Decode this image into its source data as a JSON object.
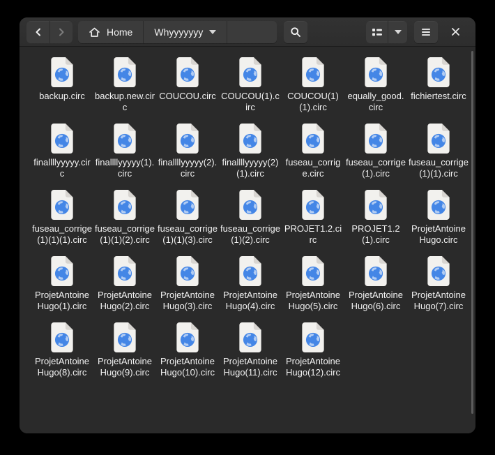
{
  "headerbar": {
    "home_label": "Home",
    "current_folder": "Whyyyyyyy",
    "path_entry_value": ""
  },
  "icons": {
    "back": "chevron-left-icon",
    "forward": "chevron-right-icon",
    "home": "house-icon",
    "folder_dropdown": "chevron-down-icon",
    "search": "magnifier-icon",
    "view": "list-view-icon",
    "view_dropdown": "chevron-down-icon",
    "menu": "hamburger-icon",
    "close": "close-x-icon",
    "file": "circ-document-globe-icon"
  },
  "colors": {
    "window_bg": "#2a2a2a",
    "headerbar_bg": "#2f2f2f",
    "button_bg": "#3b3b3b",
    "separator": "#1c1c1c",
    "text": "#f1f1f1",
    "file_icon_page": "#f2f1ee",
    "file_icon_fold": "#d8d5d1",
    "file_icon_globe": "#4486e6",
    "file_icon_land": "#b3cdf3",
    "scrollbar_thumb": "#5c5c5c"
  },
  "files": [
    "backup.circ",
    "backup.new.circ",
    "COUCOU.circ",
    "COUCOU(1).circ",
    "COUCOU(1)(1).circ",
    "equally_good.circ",
    "fichiertest.circ",
    "finallllyyyyy.circ",
    "finallllyyyyy(1).circ",
    "finallllyyyyy(2).circ",
    "finallllyyyyy(2)(1).circ",
    "fuseau_corrige.circ",
    "fuseau_corrige(1).circ",
    "fuseau_corrige(1)(1).circ",
    "fuseau_corrige(1)(1)(1).circ",
    "fuseau_corrige(1)(1)(2).circ",
    "fuseau_corrige(1)(1)(3).circ",
    "fuseau_corrige(1)(2).circ",
    "PROJET1.2.circ",
    "PROJET1.2(1).circ",
    "ProjetAntoineHugo.circ",
    "ProjetAntoineHugo(1).circ",
    "ProjetAntoineHugo(2).circ",
    "ProjetAntoineHugo(3).circ",
    "ProjetAntoineHugo(4).circ",
    "ProjetAntoineHugo(5).circ",
    "ProjetAntoineHugo(6).circ",
    "ProjetAntoineHugo(7).circ",
    "ProjetAntoineHugo(8).circ",
    "ProjetAntoineHugo(9).circ",
    "ProjetAntoineHugo(10).circ",
    "ProjetAntoineHugo(11).circ",
    "ProjetAntoineHugo(12).circ"
  ]
}
